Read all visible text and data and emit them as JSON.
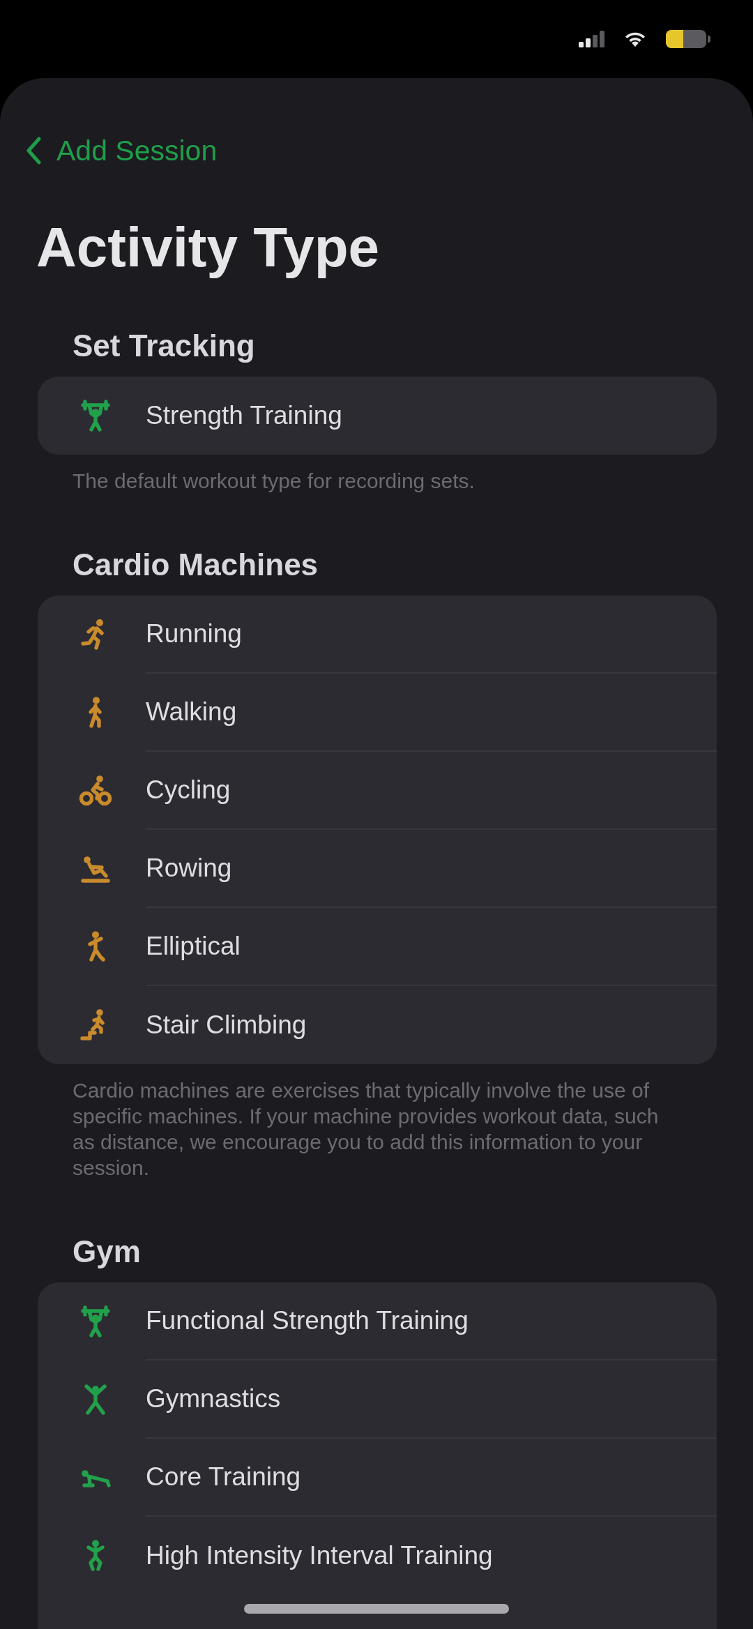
{
  "navigation": {
    "back_label": "Add Session"
  },
  "title": "Activity Type",
  "sections": [
    {
      "header": "Set Tracking",
      "color": "#22a04b",
      "items": [
        {
          "label": "Strength Training"
        }
      ],
      "footer": "The default workout type for recording sets."
    },
    {
      "header": "Cardio Machines",
      "color": "#c98b2b",
      "items": [
        {
          "label": "Running"
        },
        {
          "label": "Walking"
        },
        {
          "label": "Cycling"
        },
        {
          "label": "Rowing"
        },
        {
          "label": "Elliptical"
        },
        {
          "label": "Stair Climbing"
        }
      ],
      "footer": "Cardio machines are exercises that typically involve the use of specific machines. If your machine provides workout data, such as distance, we encourage you to add this information to your session."
    },
    {
      "header": "Gym",
      "color": "#22a04b",
      "items": [
        {
          "label": "Functional Strength Training"
        },
        {
          "label": "Gymnastics"
        },
        {
          "label": "Core Training"
        },
        {
          "label": "High Intensity Interval Training"
        }
      ]
    }
  ]
}
